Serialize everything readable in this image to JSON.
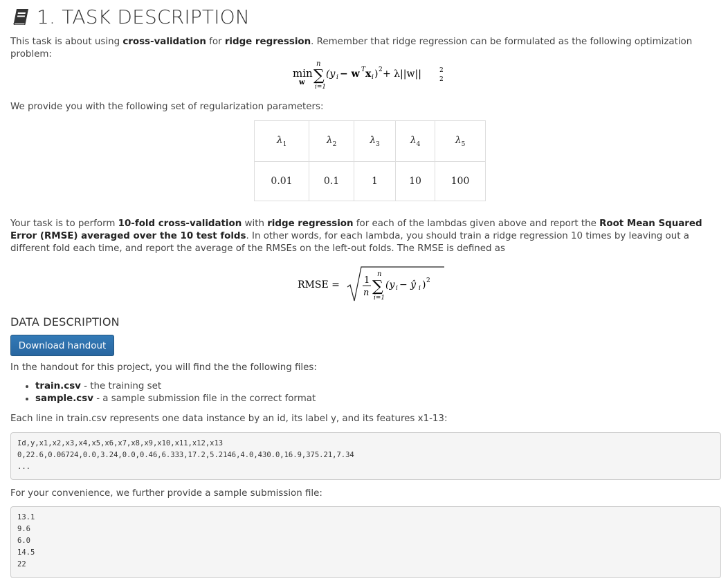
{
  "title": "1. TASK DESCRIPTION",
  "intro": {
    "before": "This task is about using ",
    "b1": "cross-validation",
    "mid": " for ",
    "b2": "ridge regression",
    "after": ". Remember that ridge regression can be formulated as the following optimization problem:"
  },
  "equation1": {
    "min": "min",
    "var": "w",
    "upper": "n",
    "lower": "i=1",
    "body": "(y",
    "sub_i": "i",
    "minus": " − w",
    "sup_T": "T",
    "x": "x",
    "rest": ")",
    "sq": "2",
    "plus": " + λ||w||",
    "norm_sup": "2",
    "norm_sub": "2"
  },
  "params_text": "We provide you with the following set of regularization parameters:",
  "lambda_table": {
    "headers": [
      "λ1",
      "λ2",
      "λ3",
      "λ4",
      "λ5"
    ],
    "header_base": "λ",
    "header_subs": [
      "1",
      "2",
      "3",
      "4",
      "5"
    ],
    "values": [
      "0.01",
      "0.1",
      "1",
      "10",
      "100"
    ]
  },
  "task_paragraph": {
    "t1": "Your task is to perform ",
    "b1": "10-fold cross-validation",
    "t2": " with ",
    "b2": "ridge regression",
    "t3": " for each of the lambdas given above and report the ",
    "b3": "Root Mean Squared Error (RMSE) averaged over the 10 test folds",
    "t4": ". In other words, for each lambda, you should train a ridge regression 10 times by leaving out a different fold each time, and report the average of the RMSEs on the left-out folds. The RMSE is defined as"
  },
  "equation2": {
    "lhs": "RMSE =",
    "num": "1",
    "den": "n",
    "upper": "n",
    "lower": "i=1",
    "body": "(y",
    "sub_i": "i",
    "minus": " − ŷ",
    "sub_i2": "i",
    "rest": ")",
    "sq": "2"
  },
  "data_heading": "DATA DESCRIPTION",
  "download_button": "Download handout",
  "handout_text": "In the handout for this project, you will find the the following files:",
  "files": [
    {
      "name": "train.csv",
      "desc": " - the training set"
    },
    {
      "name": "sample.csv",
      "desc": " - a sample submission file in the correct format"
    }
  ],
  "each_line_text": "Each line in train.csv represents one data instance by an id, its label y, and its features x1-13:",
  "train_sample": "Id,y,x1,x2,x3,x4,x5,x6,x7,x8,x9,x10,x11,x12,x13\n0,22.6,0.06724,0.0,3.24,0.0,0.46,6.333,17.2,5.2146,4.0,430.0,16.9,375.21,7.34\n...",
  "convenience_text": "For your convenience, we further provide a sample submission file:",
  "submission_sample": "13.1\n9.6\n6.0\n14.5\n22"
}
